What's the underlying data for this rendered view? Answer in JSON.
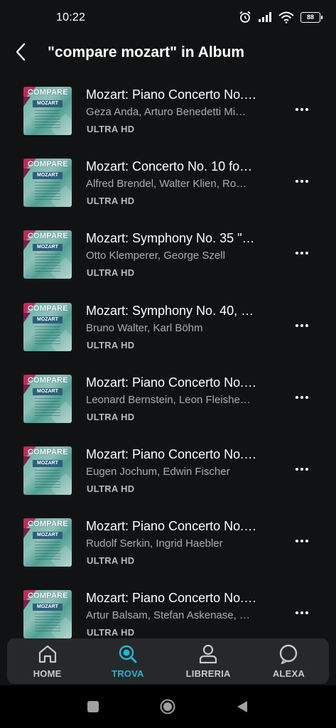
{
  "status": {
    "time": "10:22",
    "battery": "88",
    "icons": [
      "alarm-icon",
      "signal-icon",
      "wifi-icon",
      "battery-icon"
    ]
  },
  "header": {
    "title": "\"compare mozart\" in Album"
  },
  "albums": [
    {
      "title": "Mozart: Piano Concerto No.…",
      "artists": "Geza Anda, Arturo Benedetti Mi…",
      "badge": "ULTRA HD",
      "cover_text": "COMPARE",
      "cover_sub": "MOZART"
    },
    {
      "title": "Mozart: Concerto No. 10 fo…",
      "artists": "Alfred Brendel, Walter Klien, Ro…",
      "badge": "ULTRA HD",
      "cover_text": "COMPARE",
      "cover_sub": "MOZART"
    },
    {
      "title": "Mozart: Symphony No. 35 \"…",
      "artists": "Otto Klemperer, George Szell",
      "badge": "ULTRA HD",
      "cover_text": "COMPARE",
      "cover_sub": "MOZART"
    },
    {
      "title": "Mozart: Symphony No. 40, …",
      "artists": "Bruno Walter, Karl Böhm",
      "badge": "ULTRA HD",
      "cover_text": "COMPARE",
      "cover_sub": "MOZART"
    },
    {
      "title": "Mozart: Piano Concerto No.…",
      "artists": "Leonard Bernstein, Leon Fleishe…",
      "badge": "ULTRA HD",
      "cover_text": "COMPARE",
      "cover_sub": "MOZART"
    },
    {
      "title": "Mozart: Piano Concerto No.…",
      "artists": "Eugen Jochum, Edwin Fischer",
      "badge": "ULTRA HD",
      "cover_text": "COMPARE",
      "cover_sub": "MOZART"
    },
    {
      "title": "Mozart: Piano Concerto No.…",
      "artists": "Rudolf Serkin, Ingrid Haebler",
      "badge": "ULTRA HD",
      "cover_text": "COMPARE",
      "cover_sub": "MOZART"
    },
    {
      "title": "Mozart: Piano Concerto No.…",
      "artists": "Artur Balsam, Stefan Askenase, …",
      "badge": "ULTRA HD",
      "cover_text": "COMPARE",
      "cover_sub": "MOZART"
    }
  ],
  "nav": {
    "home": "HOME",
    "trova": "TROVA",
    "libreria": "LIBRERIA",
    "alexa": "ALEXA",
    "active": "trova",
    "accent_color": "#1fb7d6"
  },
  "system_nav": {
    "icons": [
      "recents-square-icon",
      "home-circle-icon",
      "back-triangle-icon"
    ]
  }
}
